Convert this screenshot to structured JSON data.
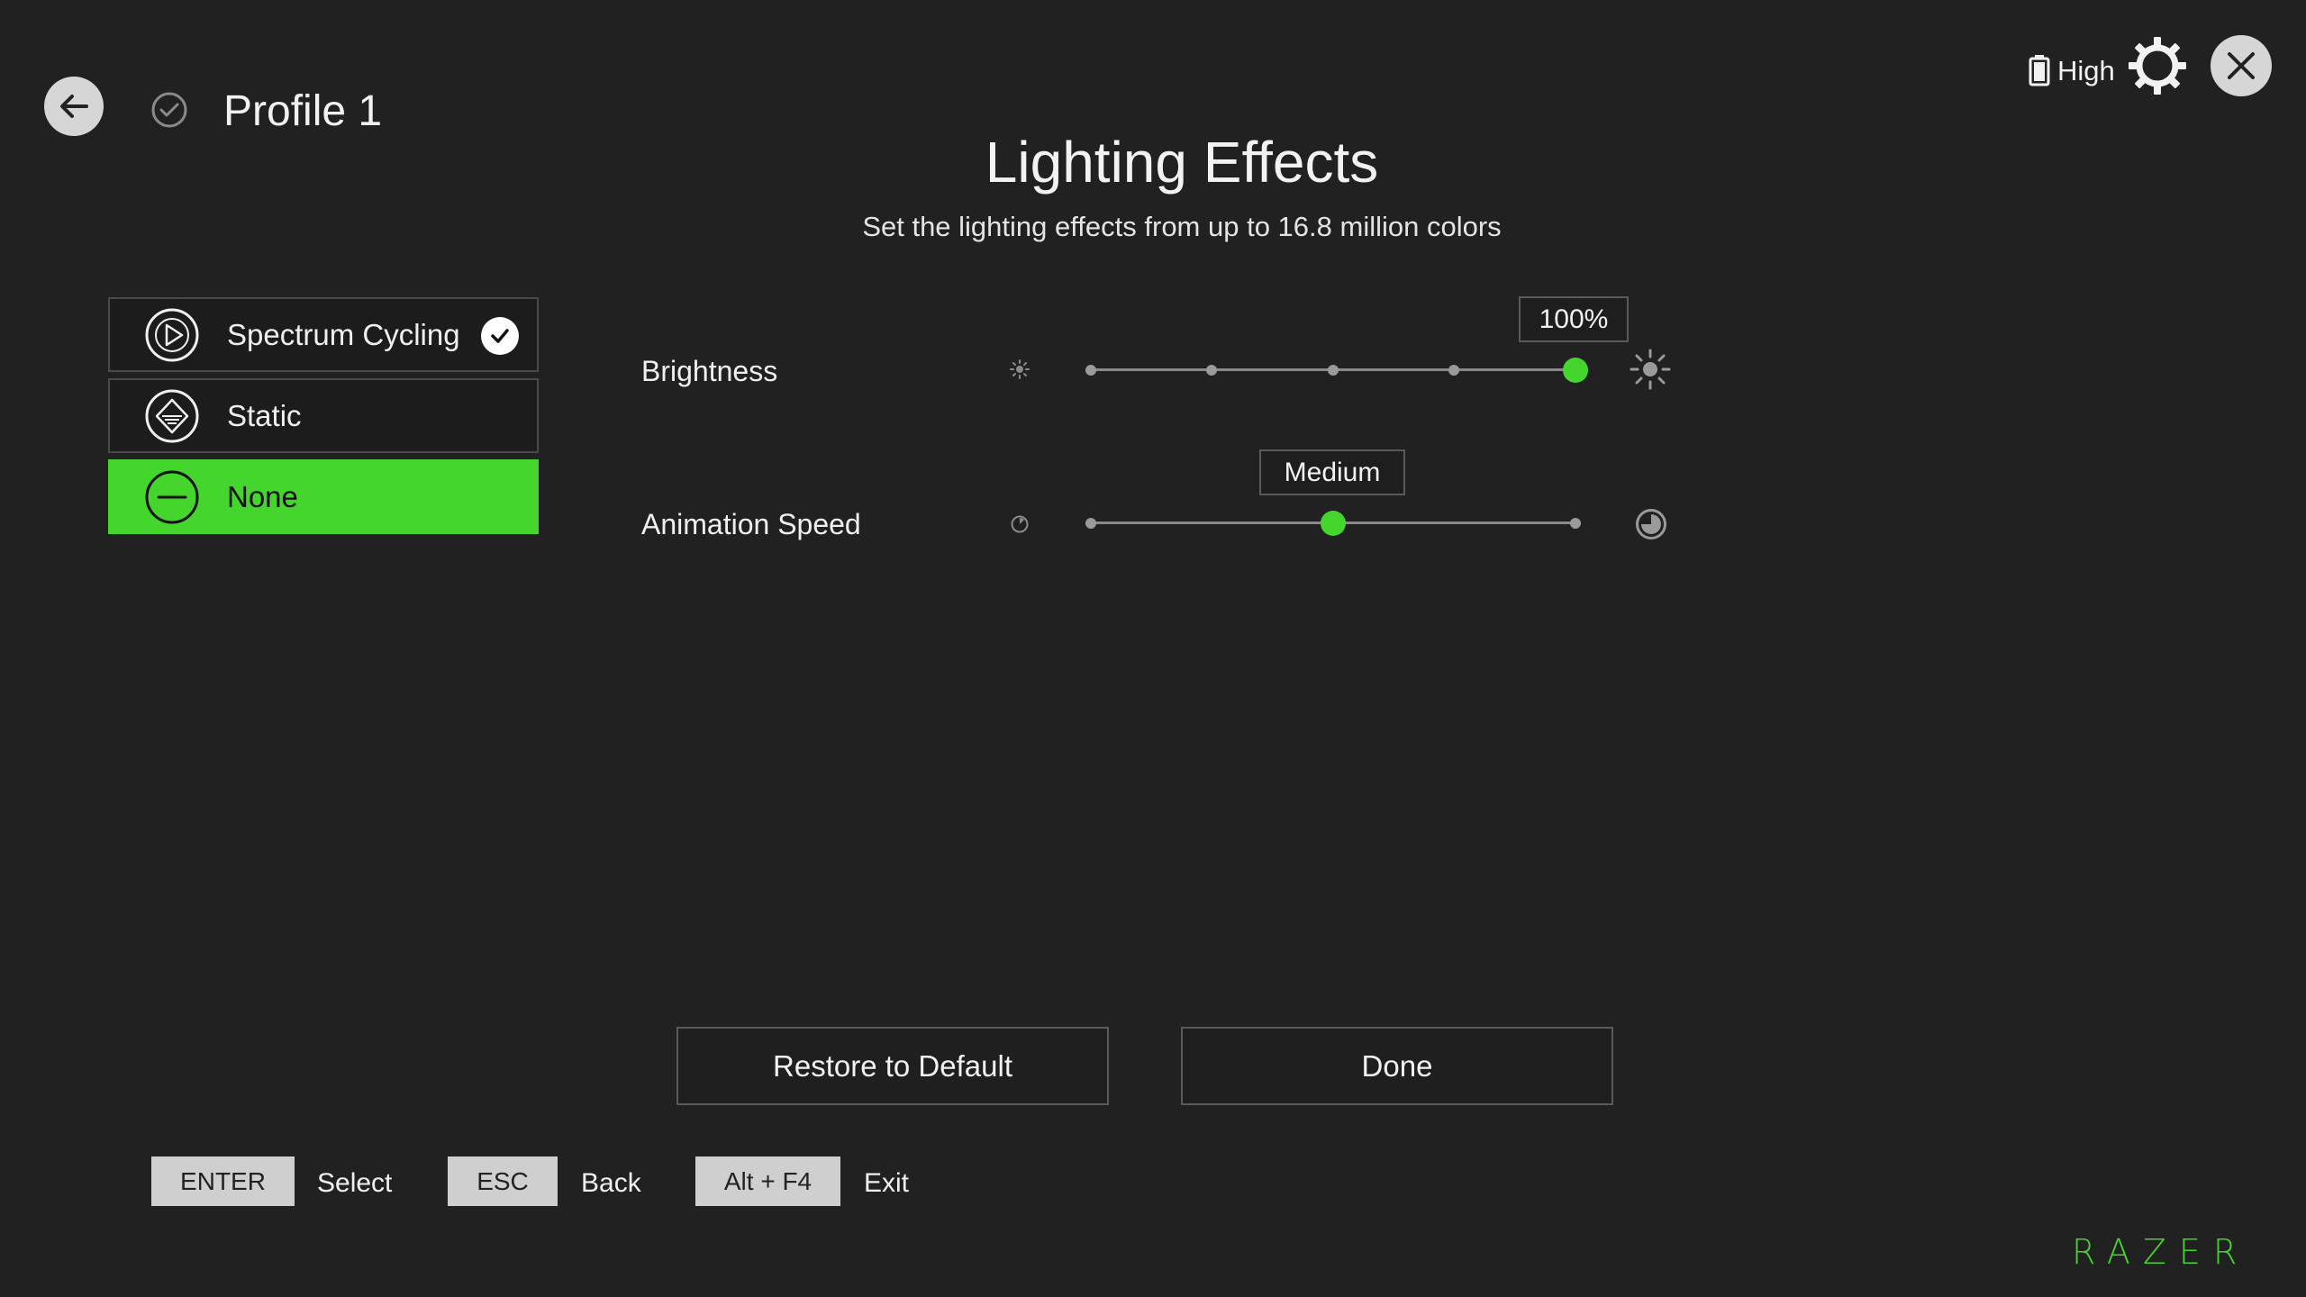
{
  "header": {
    "profile_name": "Profile 1",
    "title": "Lighting Effects",
    "subtitle": "Set the lighting effects from up to 16.8 million colors"
  },
  "status": {
    "battery_level": "High"
  },
  "effects": [
    {
      "label": "Spectrum Cycling",
      "icon": "spectrum-cycling-icon",
      "checked": true
    },
    {
      "label": "Static",
      "icon": "static-icon",
      "checked": false
    },
    {
      "label": "None",
      "icon": "none-icon",
      "selected": true
    }
  ],
  "brightness": {
    "label": "Brightness",
    "value_label": "100%",
    "value_percent": 100,
    "steps": 5
  },
  "animation_speed": {
    "label": "Animation Speed",
    "value_label": "Medium",
    "value_fraction": 0.5
  },
  "buttons": {
    "restore": "Restore to Default",
    "done": "Done"
  },
  "key_hints": [
    {
      "key": "ENTER",
      "action": "Select"
    },
    {
      "key": "ESC",
      "action": "Back"
    },
    {
      "key": "Alt + F4",
      "action": "Exit"
    }
  ],
  "brand": {
    "logo_text": "RAZER",
    "accent_color": "#44d62c"
  }
}
